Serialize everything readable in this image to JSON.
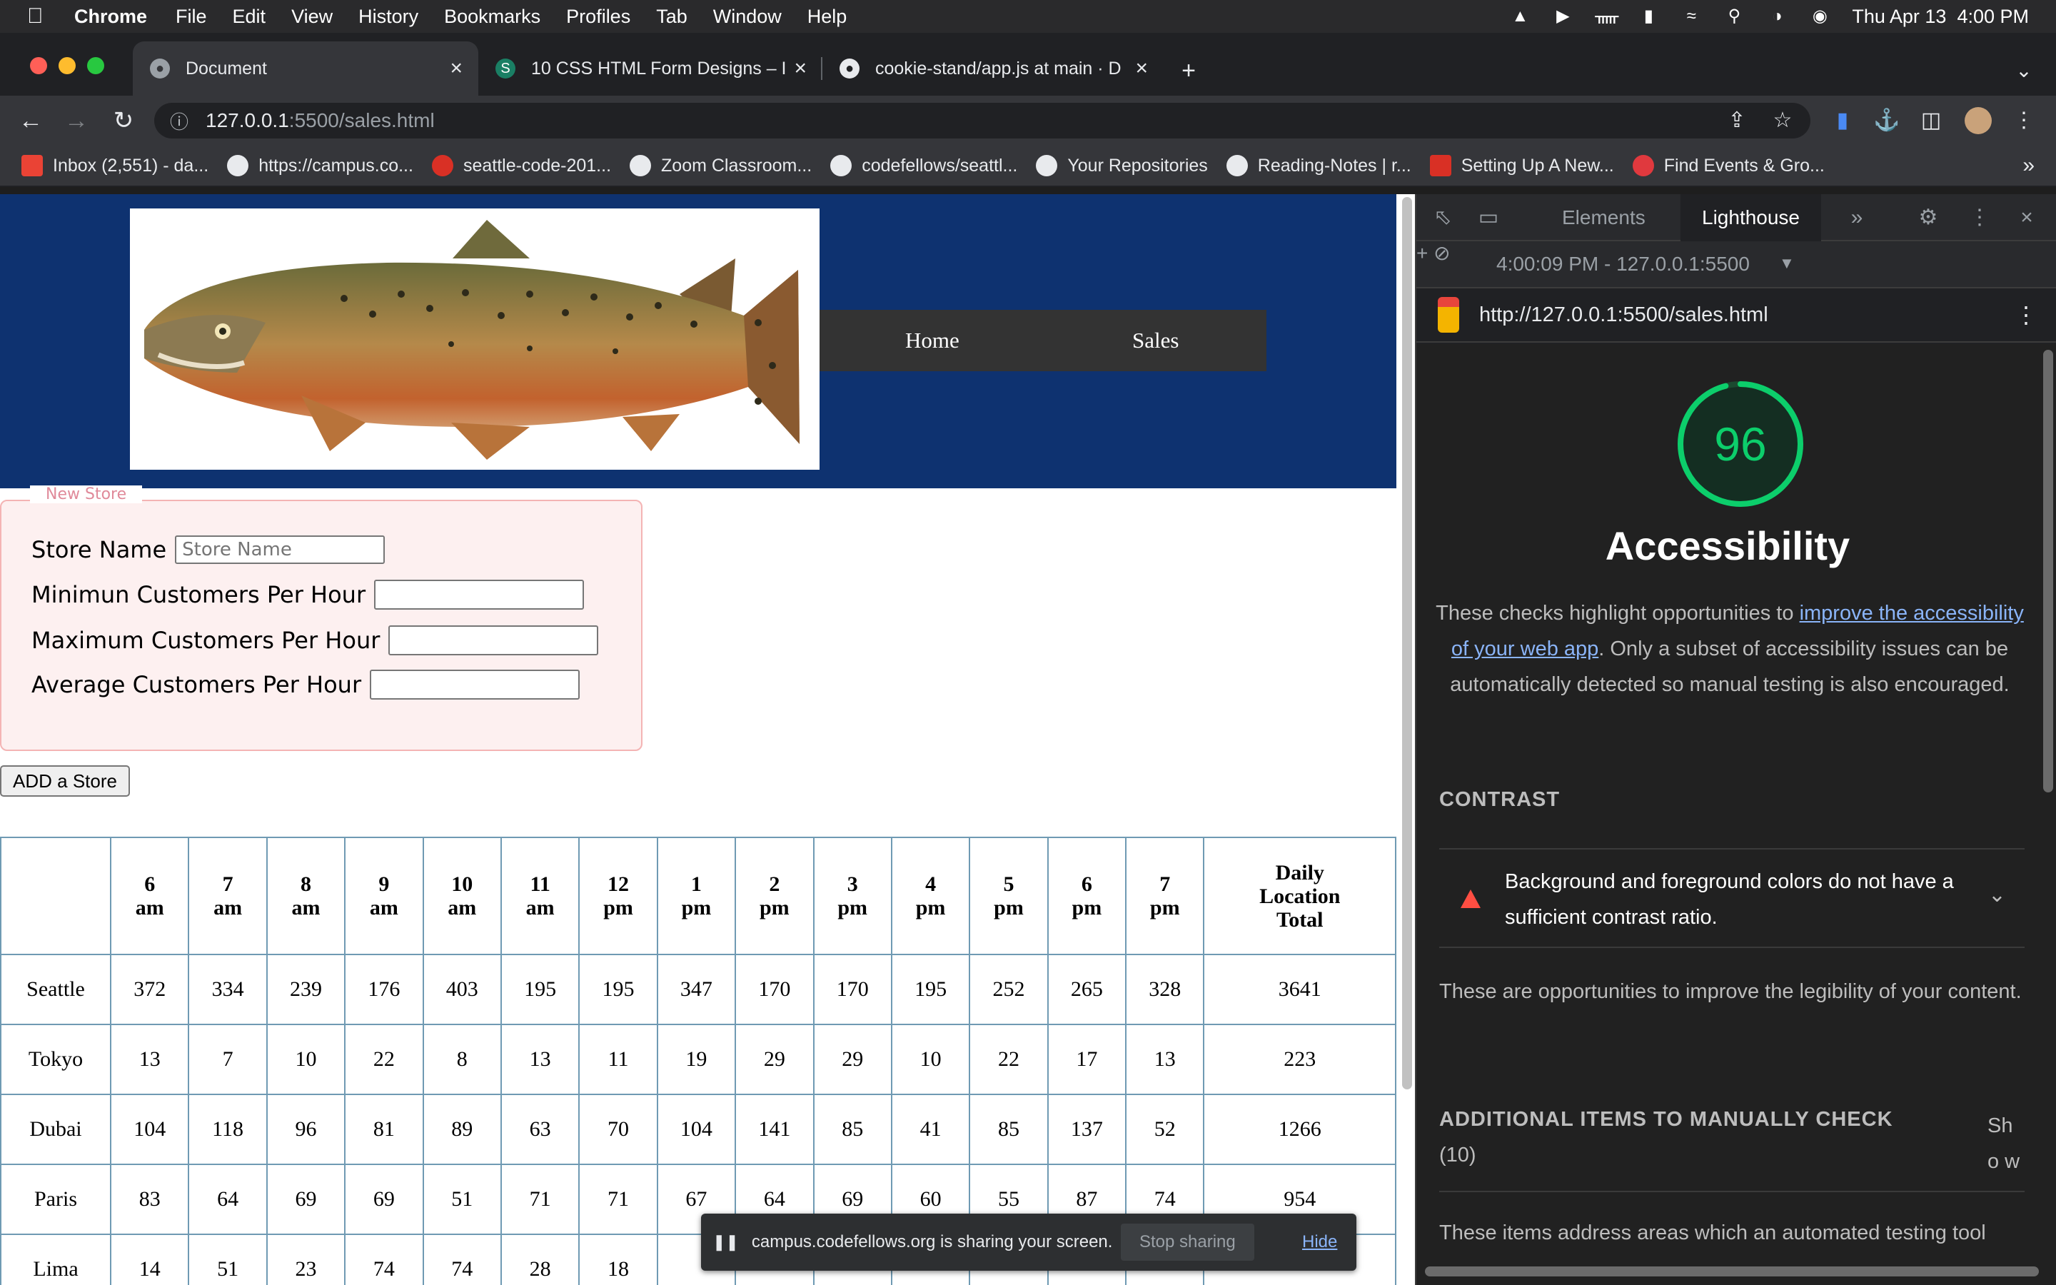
{
  "menubar": {
    "app": "Chrome",
    "items": [
      "File",
      "Edit",
      "View",
      "History",
      "Bookmarks",
      "Profiles",
      "Tab",
      "Window",
      "Help"
    ],
    "clock": "Thu Apr 13  4:00 PM"
  },
  "tabs": [
    {
      "title": "Document",
      "active": true
    },
    {
      "title": "10 CSS HTML Form Designs – I",
      "active": false
    },
    {
      "title": "cookie-stand/app.js at main · D",
      "active": false
    }
  ],
  "omnibox": {
    "host": "127.0.0.1",
    "path": ":5500/sales.html"
  },
  "bookmarks": [
    "Inbox (2,551) - da...",
    "https://campus.co...",
    "seattle-code-201...",
    "Zoom Classroom...",
    "codefellows/seattl...",
    "Your Repositories",
    "Reading-Notes | r...",
    "Setting Up A New...",
    "Find Events & Gro..."
  ],
  "page": {
    "nav": {
      "home": "Home",
      "sales": "Sales"
    },
    "form": {
      "legend": "New Store",
      "fields": [
        {
          "label": "Store Name",
          "placeholder": "Store Name",
          "value": ""
        },
        {
          "label": "Minimun Customers Per Hour",
          "placeholder": "",
          "value": ""
        },
        {
          "label": "Maximum Customers Per Hour",
          "placeholder": "",
          "value": ""
        },
        {
          "label": "Average Customers Per Hour",
          "placeholder": "",
          "value": ""
        }
      ],
      "submit": "ADD a Store"
    },
    "table": {
      "headers": [
        [
          "6",
          "am"
        ],
        [
          "7",
          "am"
        ],
        [
          "8",
          "am"
        ],
        [
          "9",
          "am"
        ],
        [
          "10",
          "am"
        ],
        [
          "11",
          "am"
        ],
        [
          "12",
          "pm"
        ],
        [
          "1",
          "pm"
        ],
        [
          "2",
          "pm"
        ],
        [
          "3",
          "pm"
        ],
        [
          "4",
          "pm"
        ],
        [
          "5",
          "pm"
        ],
        [
          "6",
          "pm"
        ],
        [
          "7",
          "pm"
        ],
        [
          "Daily",
          "Location",
          "Total"
        ]
      ],
      "rows": [
        {
          "city": "Seattle",
          "values": [
            "372",
            "334",
            "239",
            "176",
            "403",
            "195",
            "195",
            "347",
            "170",
            "170",
            "195",
            "252",
            "265",
            "328",
            "3641"
          ]
        },
        {
          "city": "Tokyo",
          "values": [
            "13",
            "7",
            "10",
            "22",
            "8",
            "13",
            "11",
            "19",
            "29",
            "29",
            "10",
            "22",
            "17",
            "13",
            "223"
          ]
        },
        {
          "city": "Dubai",
          "values": [
            "104",
            "118",
            "96",
            "81",
            "89",
            "63",
            "70",
            "104",
            "141",
            "85",
            "41",
            "85",
            "137",
            "52",
            "1266"
          ]
        },
        {
          "city": "Paris",
          "values": [
            "83",
            "64",
            "69",
            "69",
            "51",
            "71",
            "71",
            "67",
            "64",
            "69",
            "60",
            "55",
            "87",
            "74",
            "954"
          ]
        },
        {
          "city": "Lima",
          "values": [
            "14",
            "51",
            "23",
            "74",
            "74",
            "28",
            "18",
            "",
            "",
            "",
            "",
            "",
            "",
            "",
            ""
          ]
        }
      ]
    }
  },
  "share_banner": {
    "text": "campus.codefellows.org is sharing your screen.",
    "stop": "Stop sharing",
    "hide": "Hide"
  },
  "devtools": {
    "tabs": [
      "Elements",
      "Lighthouse"
    ],
    "report_select": "4:00:09 PM - 127.0.0.1:5500",
    "url": "http://127.0.0.1:5500/sales.html",
    "score": "96",
    "score_fraction": 0.96,
    "category": "Accessibility",
    "desc_pre": "These checks highlight opportunities to ",
    "desc_link": "improve the accessibility of your web app",
    "desc_post": ". Only a subset of accessibility issues can be automatically detected so manual testing is also encouraged.",
    "contrast_heading": "CONTRAST",
    "contrast_audit": "Background and foreground colors do not have a sufficient contrast ratio.",
    "contrast_note": "These are opportunities to improve the legibility of your content.",
    "manual_heading": "ADDITIONAL ITEMS TO MANUALLY CHECK",
    "manual_count": "(10)",
    "show": "Sho w",
    "manual_note": "These items address areas which an automated testing tool"
  },
  "colors": {
    "header_bg": "#0e3270",
    "nav_bg": "#333333",
    "score_green": "#0cce6b",
    "fail_red": "#ff4e42"
  }
}
